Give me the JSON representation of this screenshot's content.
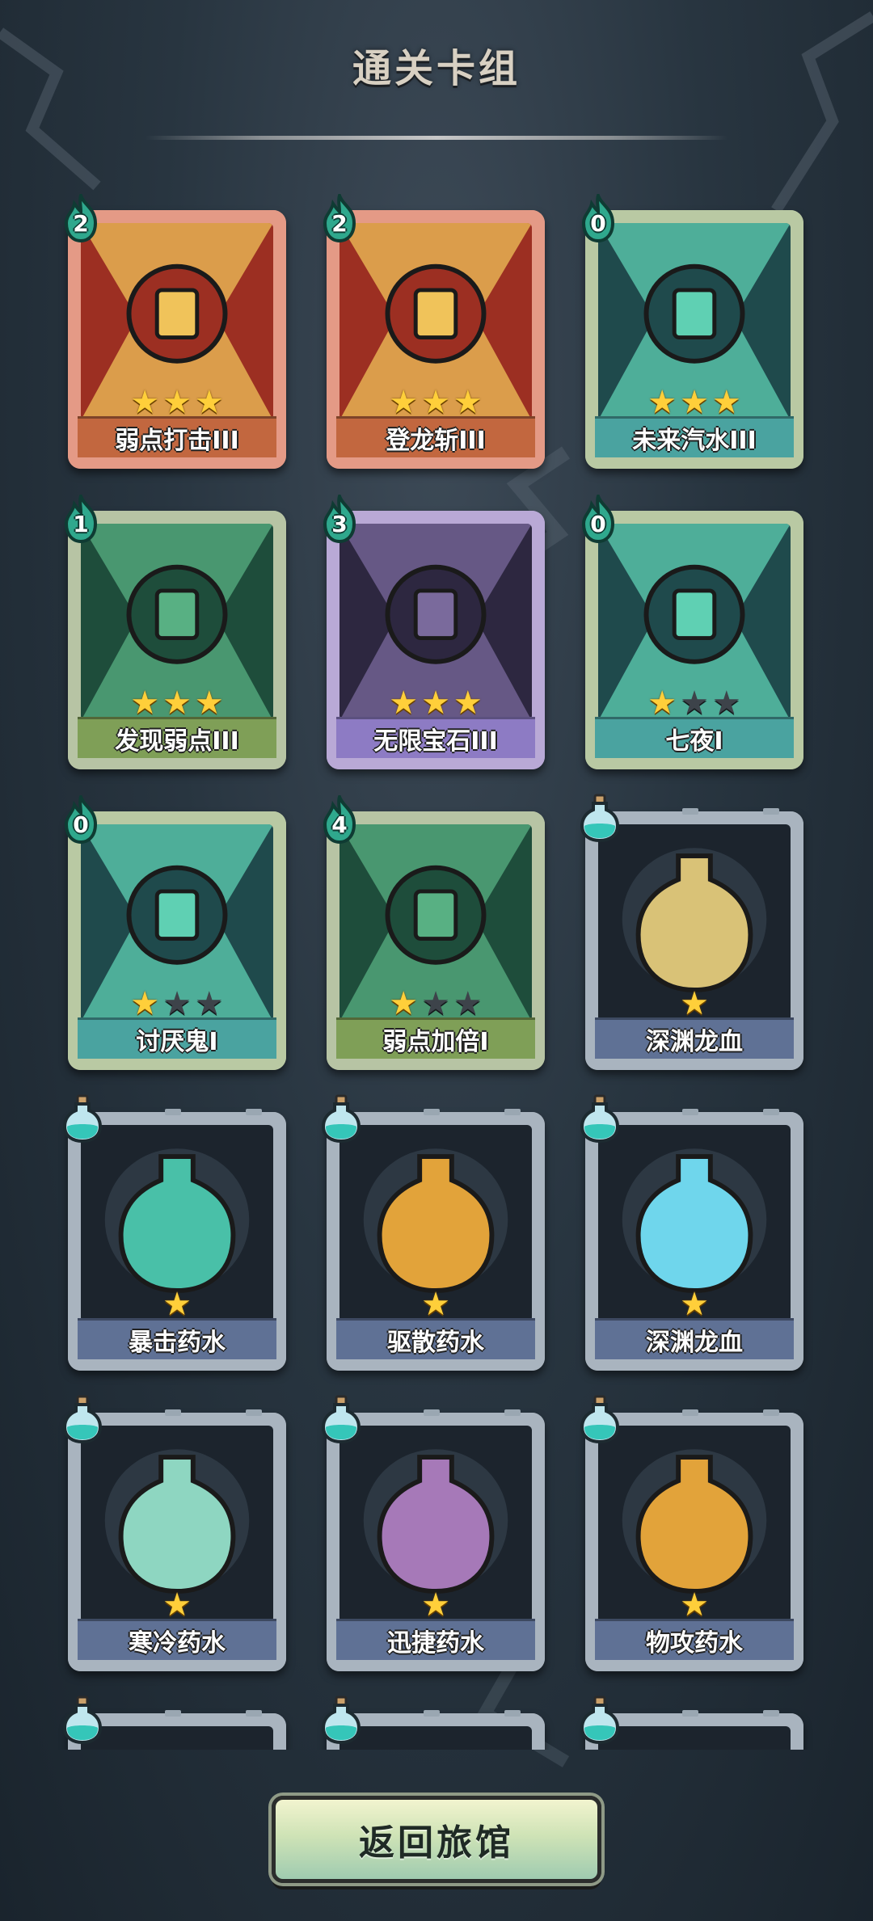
{
  "title": "通关卡组",
  "button_label": "返回旅馆",
  "cards": [
    {
      "name": "弱点打击III",
      "cost": "2",
      "stars": 3,
      "max": 3,
      "type": "skill",
      "theme": "orange"
    },
    {
      "name": "登龙斩III",
      "cost": "2",
      "stars": 3,
      "max": 3,
      "type": "skill",
      "theme": "orange"
    },
    {
      "name": "未来汽水III",
      "cost": "0",
      "stars": 3,
      "max": 3,
      "type": "skill",
      "theme": "teal"
    },
    {
      "name": "发现弱点III",
      "cost": "1",
      "stars": 3,
      "max": 3,
      "type": "skill",
      "theme": "green"
    },
    {
      "name": "无限宝石III",
      "cost": "3",
      "stars": 3,
      "max": 3,
      "type": "skill",
      "theme": "purple"
    },
    {
      "name": "七夜I",
      "cost": "0",
      "stars": 1,
      "max": 3,
      "type": "skill",
      "theme": "teal"
    },
    {
      "name": "讨厌鬼I",
      "cost": "0",
      "stars": 1,
      "max": 3,
      "type": "skill",
      "theme": "teal"
    },
    {
      "name": "弱点加倍I",
      "cost": "4",
      "stars": 1,
      "max": 3,
      "type": "skill",
      "theme": "green"
    },
    {
      "name": "深渊龙血",
      "cost": "",
      "stars": 1,
      "max": 1,
      "type": "potion",
      "theme": "slate"
    },
    {
      "name": "暴击药水",
      "cost": "",
      "stars": 1,
      "max": 1,
      "type": "potion",
      "theme": "slate"
    },
    {
      "name": "驱散药水",
      "cost": "",
      "stars": 1,
      "max": 1,
      "type": "potion",
      "theme": "slate"
    },
    {
      "name": "深渊龙血",
      "cost": "",
      "stars": 1,
      "max": 1,
      "type": "potion",
      "theme": "slate"
    },
    {
      "name": "寒冷药水",
      "cost": "",
      "stars": 1,
      "max": 1,
      "type": "potion",
      "theme": "slate"
    },
    {
      "name": "迅捷药水",
      "cost": "",
      "stars": 1,
      "max": 1,
      "type": "potion",
      "theme": "slate"
    },
    {
      "name": "物攻药水",
      "cost": "",
      "stars": 1,
      "max": 1,
      "type": "potion",
      "theme": "slate"
    },
    {
      "name": "",
      "cost": "",
      "stars": 0,
      "max": 0,
      "type": "potion",
      "theme": "slate"
    },
    {
      "name": "",
      "cost": "",
      "stars": 0,
      "max": 0,
      "type": "potion",
      "theme": "slate"
    },
    {
      "name": "",
      "cost": "",
      "stars": 0,
      "max": 0,
      "type": "potion",
      "theme": "slate"
    }
  ],
  "icons": {
    "cost_flame": "flame-cost-icon",
    "potion": "potion-flask-icon",
    "star": "star-icon"
  },
  "colors": {
    "orange_frame": "#e49a86",
    "teal_frame": "#b9c9a3",
    "green_frame": "#b7c4a4",
    "purple_frame": "#b9a9d6",
    "slate_frame": "#a9b4bf"
  }
}
